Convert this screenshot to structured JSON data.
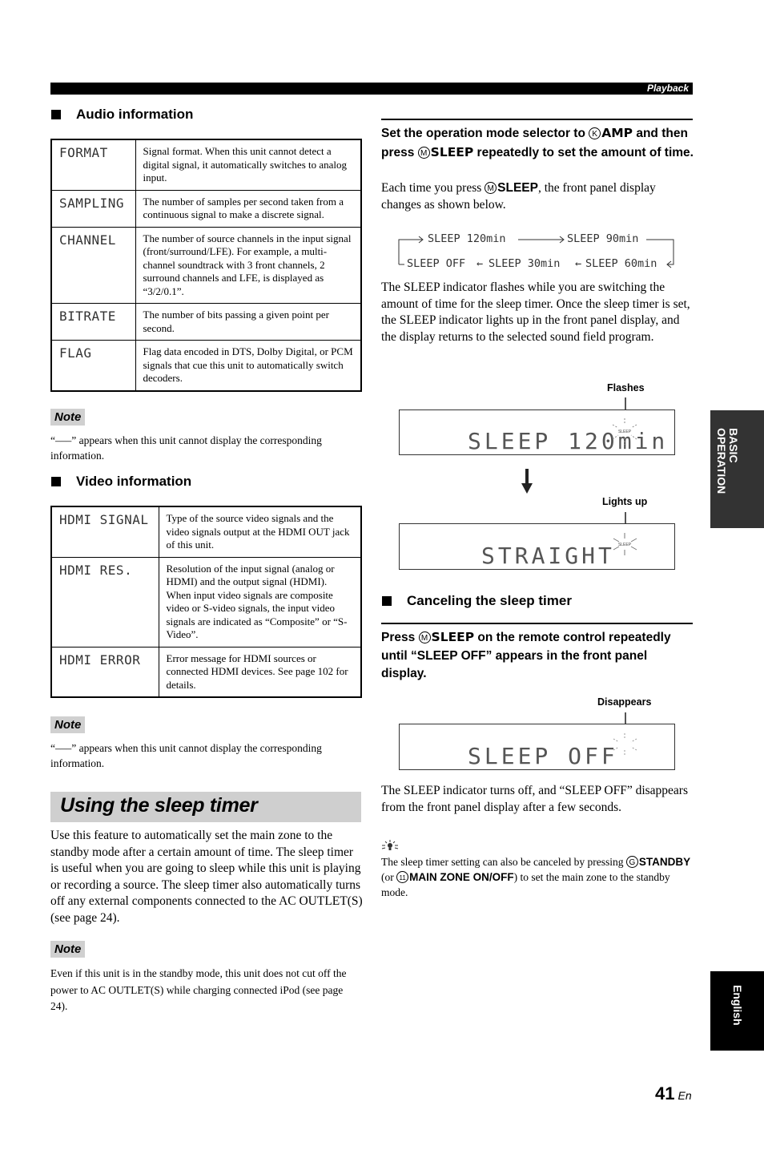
{
  "header": {
    "section_label": "Playback"
  },
  "audio_info": {
    "heading": "Audio information",
    "rows": [
      {
        "label": "FORMAT",
        "desc": "Signal format. When this unit cannot detect a digital signal, it automatically switches to analog input."
      },
      {
        "label": "SAMPLING",
        "desc": "The number of samples per second taken from a continuous signal to make a discrete signal."
      },
      {
        "label": "CHANNEL",
        "desc": "The number of source channels in the input signal (front/surround/LFE). For example, a multi-channel soundtrack with 3 front channels, 2 surround channels and LFE, is displayed as “3/2/0.1”."
      },
      {
        "label": "BITRATE",
        "desc": "The number of bits passing a given point per second."
      },
      {
        "label": "FLAG",
        "desc": "Flag data encoded in DTS, Dolby Digital, or PCM signals that cue this unit to automatically switch decoders."
      }
    ],
    "note_label": "Note",
    "note_text": "“–––” appears when this unit cannot display the corresponding information."
  },
  "video_info": {
    "heading": "Video information",
    "rows": [
      {
        "label": "HDMI SIGNAL",
        "desc": "Type of the source video signals and the video signals output at the HDMI OUT jack of this unit."
      },
      {
        "label": "HDMI RES.",
        "desc": "Resolution of the input signal (analog or HDMI) and the output signal (HDMI). When input video signals are composite video or S-video signals, the input video signals are indicated as “Composite” or “S-Video”."
      },
      {
        "label": "HDMI ERROR",
        "desc": "Error message for HDMI sources or connected HDMI devices. See page 102 for details."
      }
    ],
    "note_label": "Note",
    "note_text": "“–––” appears when this unit cannot display the corresponding information."
  },
  "sleep_timer": {
    "title": "Using the sleep timer",
    "intro": "Use this feature to automatically set the main zone to the standby mode after a certain amount of time. The sleep timer is useful when you are going to sleep while this unit is playing or recording a source. The sleep timer also automatically turns off any external components connected to the AC OUTLET(S) (see page 24).",
    "note_label": "Note",
    "note_text": "Even if this unit is in the standby mode, this unit does not cut off the power to AC OUTLET(S) while charging connected iPod (see page 24).",
    "step": {
      "part1": "Set the operation mode selector to ",
      "key1_circle": "K",
      "key1_label": "AMP",
      "part2": " and then press ",
      "key2_circle": "M",
      "key2_label": "SLEEP",
      "part3": " repeatedly to set the amount of time."
    },
    "each_time": {
      "part1": "Each time you press ",
      "key_circle": "M",
      "key_label": "SLEEP",
      "part2": ", the front panel display changes as shown below."
    },
    "cycle": [
      "SLEEP 120min",
      "SLEEP 90min",
      "SLEEP 60min",
      "SLEEP 30min",
      "SLEEP OFF"
    ],
    "indicator_text": "The SLEEP indicator flashes while you are switching the amount of time for the sleep timer. Once the sleep timer is set, the SLEEP indicator lights up in the front panel display, and the display returns to the selected sound field program.",
    "display1": {
      "callout": "Flashes",
      "text": "SLEEP 120min",
      "indicator": "SLEEP"
    },
    "display2": {
      "callout": "Lights up",
      "text": "STRAIGHT",
      "indicator": "SLEEP"
    }
  },
  "cancel": {
    "heading": "Canceling the sleep timer",
    "step": {
      "part1": "Press ",
      "key_circle": "M",
      "key_label": "SLEEP",
      "part2": " on the remote control repeatedly until “SLEEP OFF” appears in the front panel display."
    },
    "display": {
      "callout": "Disappears",
      "text": "SLEEP OFF"
    },
    "result_text": "The SLEEP indicator turns off, and “SLEEP OFF” disappears from the front panel display after a few seconds.",
    "tip": {
      "part1": "The sleep timer setting can also be canceled by pressing ",
      "key1_circle": "G",
      "key1_label": "STANDBY",
      "part2": " (or ",
      "key2_circle": "11",
      "key2_label": "MAIN ZONE ON/OFF",
      "part3": ") to set the main zone to the standby mode."
    }
  },
  "side_tabs": {
    "section": "BASIC OPERATION",
    "language": "English"
  },
  "footer": {
    "page_number": "41",
    "lang_suffix": "En"
  }
}
